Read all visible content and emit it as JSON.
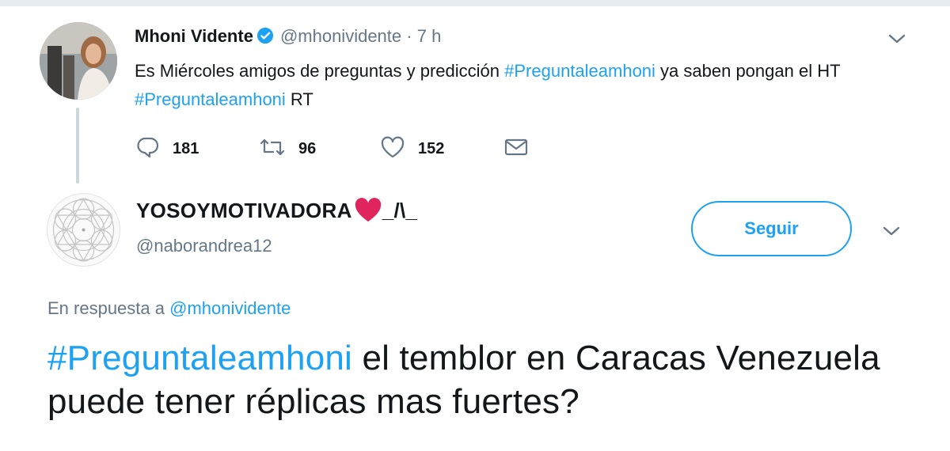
{
  "parent_tweet": {
    "name": "Mhoni Vidente",
    "handle": "@mhonividente",
    "separator": "·",
    "time": "7 h",
    "text_part1": "Es Miércoles amigos de preguntas y predicción ",
    "hashtag1": "#Preguntaleamhoni",
    "text_part2": " ya saben pongan el HT ",
    "hashtag2": "#Preguntaleamhoni",
    "text_part3": " RT",
    "reply_count": "181",
    "retweet_count": "96",
    "like_count": "152"
  },
  "reply_tweet": {
    "name": "YOSOYMOTIVADORA",
    "name_suffix": "_/\\_",
    "handle": "@naborandrea12",
    "follow_label": "Seguir",
    "in_reply_prefix": "En respuesta a ",
    "in_reply_to": "@mhonividente",
    "hashtag": "#Preguntaleamhoni",
    "text": " el temblor en Caracas Venezuela puede tener réplicas mas fuertes?"
  },
  "colors": {
    "accent": "#1da1f2",
    "secondary_text": "#657786",
    "thread_line": "#ccd6dd",
    "heart": "#e0245e"
  },
  "icons": [
    "verified-badge-icon",
    "reply-icon",
    "retweet-icon",
    "like-icon",
    "direct-message-icon",
    "chevron-down-icon",
    "heart-emoji-icon"
  ]
}
